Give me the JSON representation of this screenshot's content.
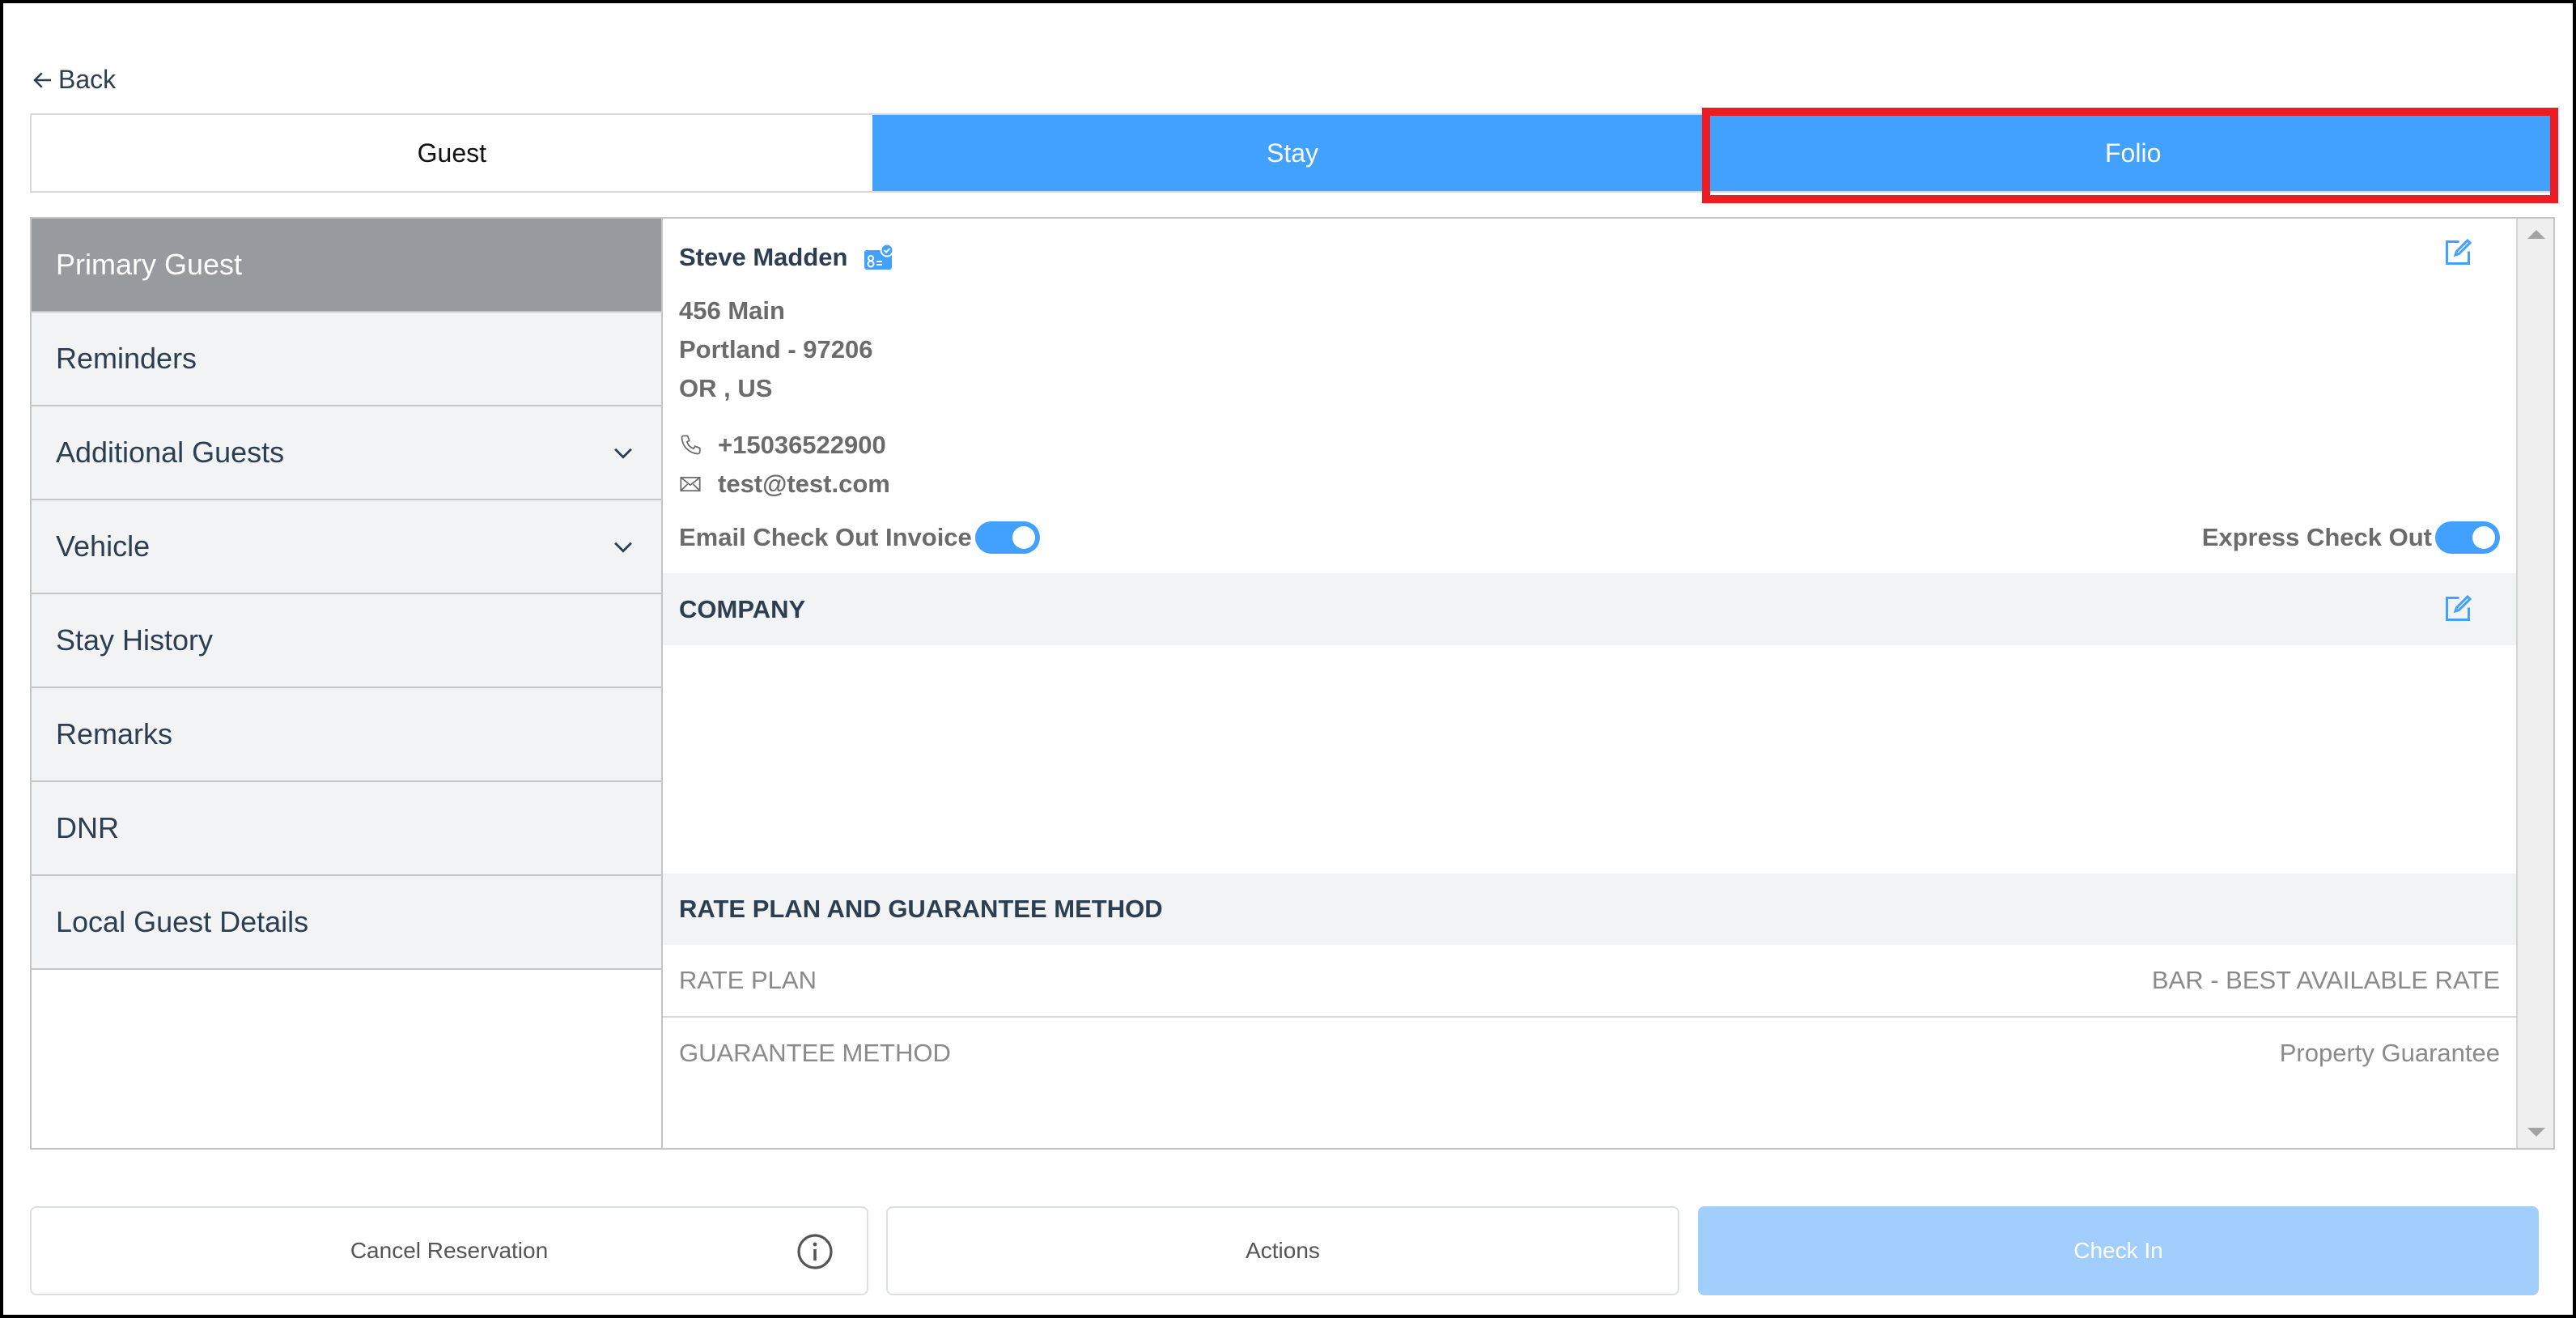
{
  "nav": {
    "back_label": "Back"
  },
  "tabs": [
    {
      "label": "Guest",
      "active": false
    },
    {
      "label": "Stay",
      "active": true
    },
    {
      "label": "Folio",
      "active": true,
      "highlighted": true
    }
  ],
  "sidebar": {
    "items": [
      {
        "label": "Primary Guest",
        "active": true,
        "expandable": false
      },
      {
        "label": "Reminders",
        "active": false,
        "expandable": false
      },
      {
        "label": "Additional Guests",
        "active": false,
        "expandable": true
      },
      {
        "label": "Vehicle",
        "active": false,
        "expandable": true
      },
      {
        "label": "Stay History",
        "active": false,
        "expandable": false
      },
      {
        "label": "Remarks",
        "active": false,
        "expandable": false
      },
      {
        "label": "DNR",
        "active": false,
        "expandable": false
      },
      {
        "label": "Local Guest Details",
        "active": false,
        "expandable": false
      }
    ]
  },
  "guest": {
    "name": "Steve Madden",
    "address_line1": "456 Main",
    "address_line2": "Portland  - 97206",
    "address_line3": "OR , US",
    "phone": "+15036522900",
    "email": "test@test.com",
    "email_checkout_invoice_label": "Email Check Out Invoice",
    "email_checkout_invoice_on": true,
    "express_checkout_label": "Express Check Out",
    "express_checkout_on": true
  },
  "company": {
    "title": "COMPANY"
  },
  "rate_plan": {
    "title": "RATE PLAN AND GUARANTEE METHOD",
    "rows": [
      {
        "label": "RATE PLAN",
        "value": "BAR - BEST AVAILABLE RATE"
      },
      {
        "label": "GUARANTEE METHOD",
        "value": "Property Guarantee"
      }
    ]
  },
  "footer": {
    "cancel_label": "Cancel Reservation",
    "actions_label": "Actions",
    "checkin_label": "Check In"
  },
  "colors": {
    "accent": "#42a0ff",
    "accent_disabled": "#a2cefd",
    "highlight": "#ed1c24",
    "sidebar_active": "#979ba0"
  }
}
